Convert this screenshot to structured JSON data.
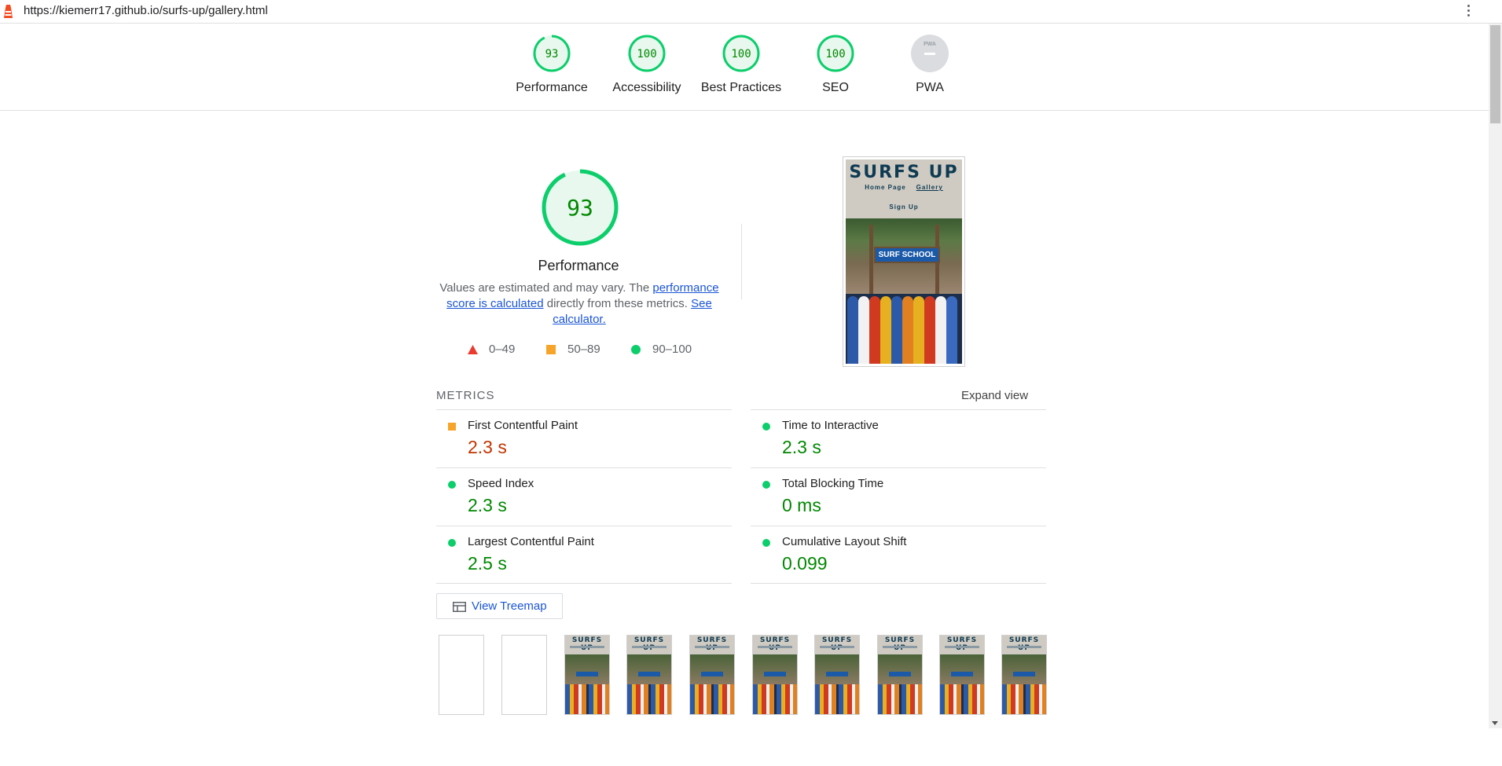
{
  "browser": {
    "url": "https://kiemerr17.github.io/surfs-up/gallery.html"
  },
  "header_scores": [
    {
      "label": "Performance",
      "score": "93",
      "value": 93
    },
    {
      "label": "Accessibility",
      "score": "100",
      "value": 100
    },
    {
      "label": "Best Practices",
      "score": "100",
      "value": 100
    },
    {
      "label": "SEO",
      "score": "100",
      "value": 100
    },
    {
      "label": "PWA",
      "score": "",
      "value": null,
      "badge": "PWA"
    }
  ],
  "performance": {
    "score": "93",
    "value": 93,
    "title": "Performance",
    "desc_prefix": "Values are estimated and may vary. The ",
    "score_link": "performance score is calculated",
    "desc_middle": " directly from these metrics. ",
    "calc_link": "See calculator.",
    "legend": [
      {
        "range": "0–49",
        "shape": "triangle",
        "color": "#eb3b2f"
      },
      {
        "range": "50–89",
        "shape": "square",
        "color": "#f7a42b"
      },
      {
        "range": "90–100",
        "shape": "circle",
        "color": "#0cce6b"
      }
    ]
  },
  "final_screenshot": {
    "site_title": "SURFS UP",
    "nav_items": [
      "Home Page",
      "Gallery"
    ],
    "nav_signup": "Sign Up",
    "sign_text": "SURF SCHOOL"
  },
  "metrics": {
    "title": "METRICS",
    "expand_label": "Expand view",
    "items": [
      {
        "name": "First Contentful Paint",
        "value": "2.3 s",
        "status": "average"
      },
      {
        "name": "Time to Interactive",
        "value": "2.3 s",
        "status": "pass"
      },
      {
        "name": "Speed Index",
        "value": "2.3 s",
        "status": "pass"
      },
      {
        "name": "Total Blocking Time",
        "value": "0 ms",
        "status": "pass"
      },
      {
        "name": "Largest Contentful Paint",
        "value": "2.5 s",
        "status": "pass"
      },
      {
        "name": "Cumulative Layout Shift",
        "value": "0.099",
        "status": "pass"
      }
    ]
  },
  "treemap": {
    "label": "View Treemap"
  },
  "filmstrip": {
    "frame_title": "SURFS UP",
    "frames": [
      "blank",
      "blank",
      "loaded",
      "loaded",
      "loaded",
      "loaded",
      "loaded",
      "loaded",
      "loaded",
      "loaded"
    ]
  },
  "colors": {
    "pass": "#0cce6b",
    "pass_text": "#008800",
    "average": "#f7a42b",
    "average_text": "#c33300",
    "fail": "#eb3b2f",
    "link": "#1a55d6"
  }
}
